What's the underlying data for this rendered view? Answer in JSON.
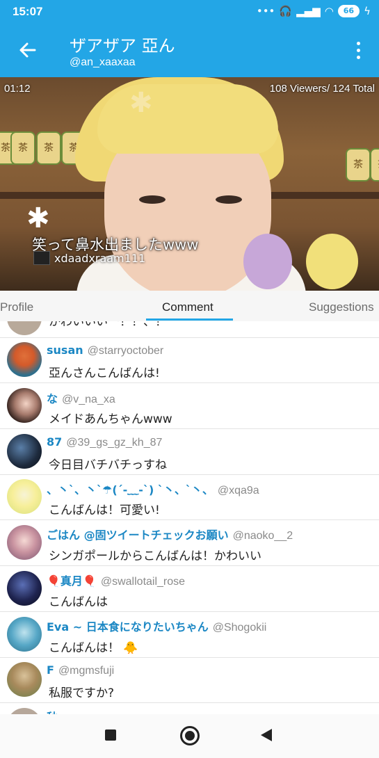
{
  "status": {
    "time": "15:07",
    "battery": "66"
  },
  "header": {
    "title": "ザアザア 亞ん",
    "handle": "@an_xaaxaa"
  },
  "video": {
    "elapsed": "01:12",
    "viewers": "108 Viewers/ 124 Total",
    "overlay_comment": "笑って鼻水出ましたwww",
    "overlay_user": "xdaadxraam111",
    "jar_label": "茶"
  },
  "tabs": [
    {
      "label": "Profile"
    },
    {
      "label": "Comment"
    },
    {
      "label": "Suggestions"
    }
  ],
  "comments": [
    {
      "name": "",
      "handle": "",
      "text": "かわいいいー！！、！"
    },
    {
      "name": "susan",
      "handle": "@starryoctober",
      "text": "亞んさんこんばんは!"
    },
    {
      "name": "な",
      "handle": "@v_na_xa",
      "text": "メイドあんちゃんwww"
    },
    {
      "name": "87",
      "handle": "@39_gs_gz_kh_87",
      "text": "今日目バチバチっすね"
    },
    {
      "name": "、丶`、丶`☂(´-﹏-`) `丶、`丶、",
      "handle": "@xqa9a",
      "text": "こんばんは！可愛い!"
    },
    {
      "name": "ごはん @固ツイートチェックお願い",
      "handle": "@naoko__2",
      "text": "シンガポールからこんばんは！かわいい"
    },
    {
      "name": "🎈真月🎈",
      "handle": "@swallotail_rose",
      "text": "こんばんは"
    },
    {
      "name": "Eva ~ 日本食になりたいちゃん",
      "handle": "@Shogokii",
      "text": "こんばんは！ 🐥"
    },
    {
      "name": "F",
      "handle": "@mgmsfuji",
      "text": "私服ですか?"
    },
    {
      "name": "秋",
      "handle": "",
      "text": ""
    }
  ]
}
